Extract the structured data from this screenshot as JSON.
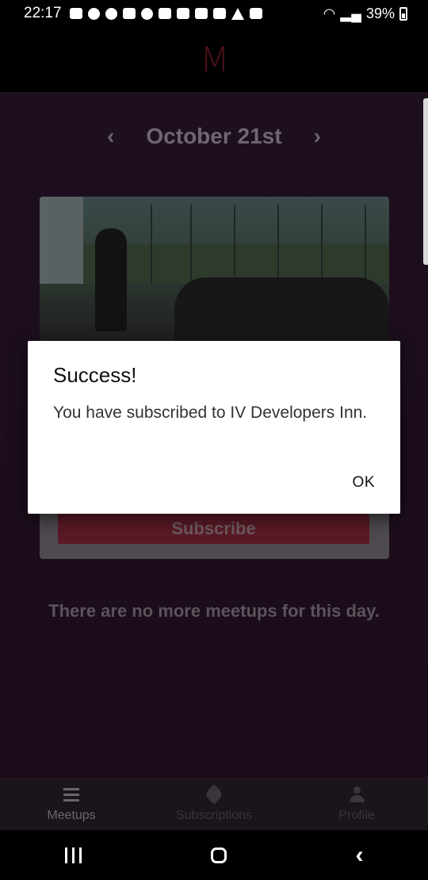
{
  "status_bar": {
    "time": "22:17",
    "battery": "39%"
  },
  "header": {
    "logo": "M"
  },
  "date_nav": {
    "title": "October 21st",
    "prev_icon": "chevron-left-icon",
    "next_icon": "chevron-right-icon"
  },
  "card": {
    "subscribe_label": "Subscribe"
  },
  "empty_message": "There are no more meetups for this day.",
  "bottom_nav": {
    "items": [
      {
        "label": "Meetups",
        "icon": "list-icon",
        "active": true
      },
      {
        "label": "Subscriptions",
        "icon": "tag-icon",
        "active": false
      },
      {
        "label": "Profile",
        "icon": "person-icon",
        "active": false
      }
    ]
  },
  "dialog": {
    "title": "Success!",
    "message": "You have subscribed to IV Developers Inn.",
    "ok_label": "OK"
  }
}
